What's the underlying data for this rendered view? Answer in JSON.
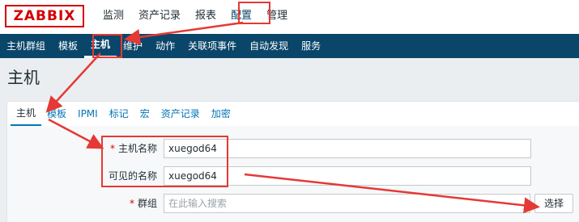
{
  "app": {
    "logo": "ZABBIX"
  },
  "top_nav": [
    "监测",
    "资产记录",
    "报表",
    "配置",
    "管理"
  ],
  "sub_nav": [
    "主机群组",
    "模板",
    "主机",
    "维护",
    "动作",
    "关联项事件",
    "自动发现",
    "服务"
  ],
  "page_title": "主机",
  "tabs": [
    "主机",
    "模板",
    "IPMI",
    "标记",
    "宏",
    "资产记录",
    "加密"
  ],
  "form": {
    "host_name": {
      "label": "主机名称",
      "value": "xuegod64"
    },
    "visible_name": {
      "label": "可见的名称",
      "value": "xuegod64"
    },
    "groups": {
      "label": "群组",
      "placeholder": "在此输入搜索",
      "select_label": "选择"
    }
  },
  "colors": {
    "brand": "#d40000",
    "nav_bg": "#0a466a",
    "annotation": "#e53935",
    "link": "#0275b8"
  }
}
